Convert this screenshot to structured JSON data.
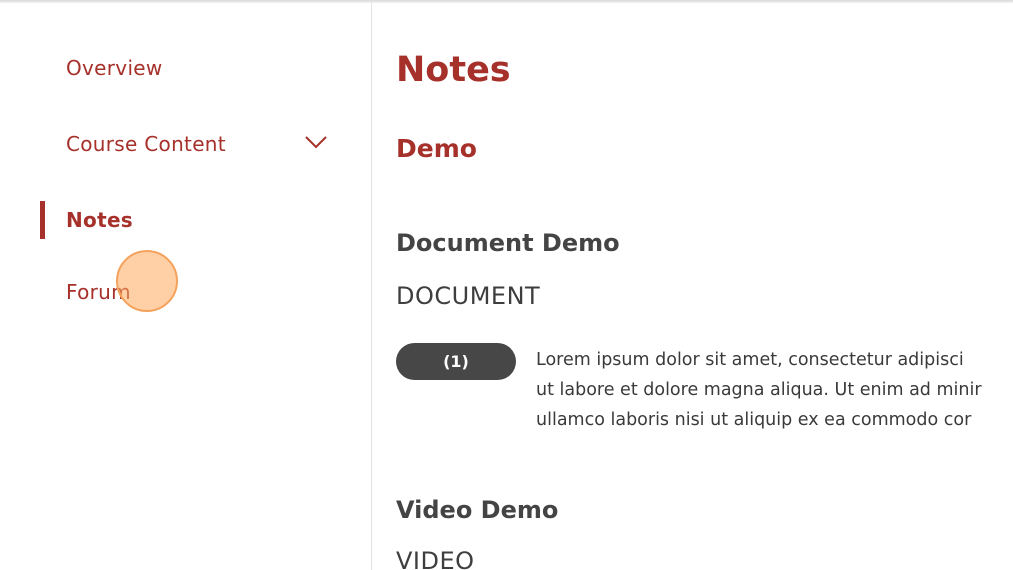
{
  "sidebar": {
    "items": [
      {
        "label": "Overview"
      },
      {
        "label": "Course Content"
      },
      {
        "label": "Notes"
      },
      {
        "label": "Forum"
      }
    ],
    "active_item": "Notes"
  },
  "main": {
    "title": "Notes",
    "section": "Demo",
    "items": [
      {
        "title": "Document Demo",
        "type": "DOCUMENT",
        "count": "(1)",
        "description_lines": [
          "Lorem ipsum dolor sit amet, consectetur adipisci",
          "ut labore et dolore magna aliqua. Ut enim ad minir",
          "ullamco laboris nisi ut aliquip ex ea commodo cor"
        ]
      },
      {
        "title": "Video Demo",
        "type": "VIDEO"
      }
    ]
  },
  "colors": {
    "accent": "#a6302a",
    "pill": "#474747",
    "cursor": "#f4a25c"
  }
}
